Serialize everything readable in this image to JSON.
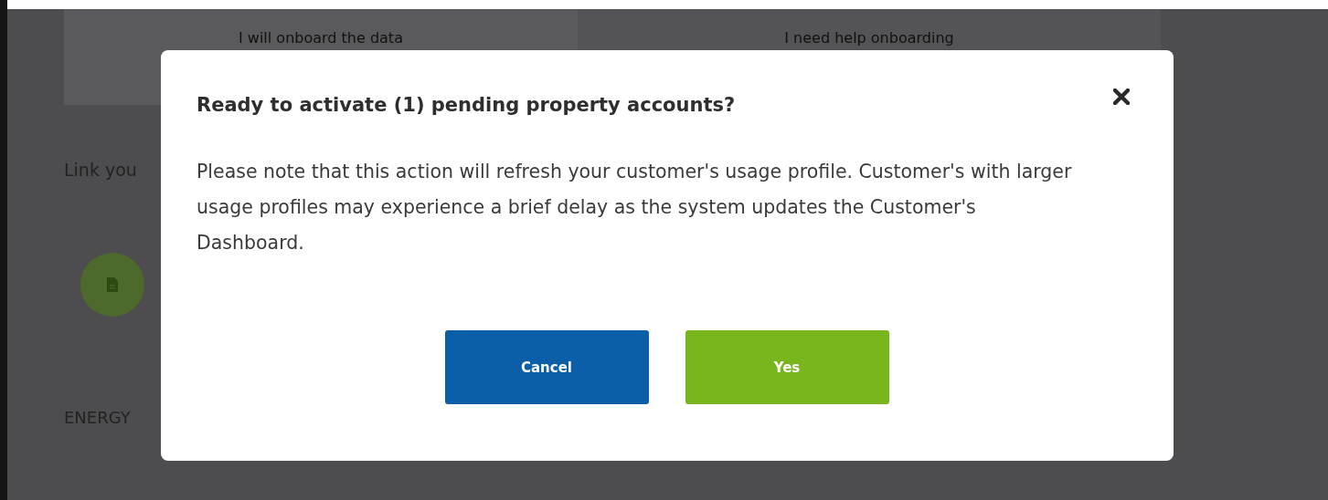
{
  "background": {
    "options": [
      "I will onboard the data",
      "I need help onboarding"
    ],
    "link_heading": "Link you",
    "section_heading": "ENERGY"
  },
  "dialog": {
    "title": "Ready to activate (1) pending property accounts?",
    "message": "Please note that this action will refresh your customer's usage profile. Customer's with larger usage profiles may experience a brief delay as the system updates the Customer's Dashboard.",
    "buttons": [
      {
        "label": "Cancel",
        "kind": "cancel"
      },
      {
        "label": "Yes",
        "kind": "confirm"
      }
    ]
  }
}
